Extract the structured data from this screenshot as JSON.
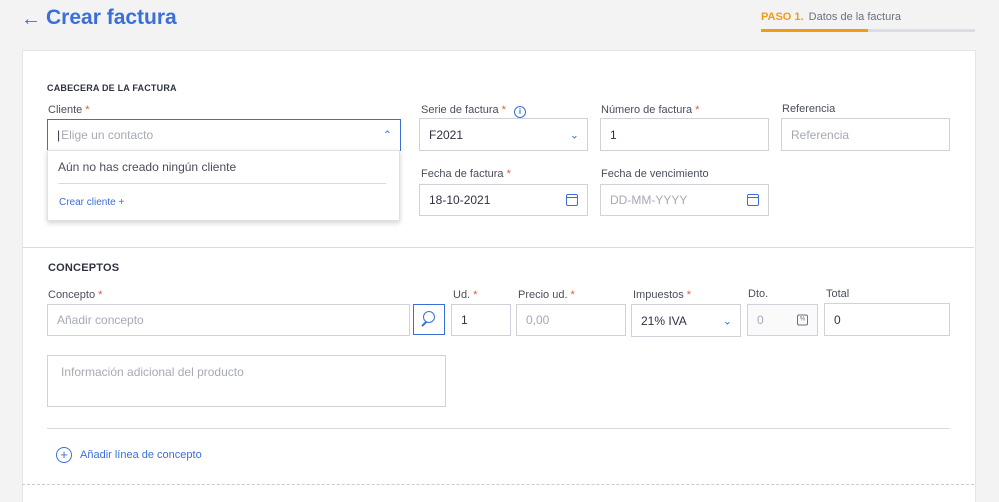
{
  "header": {
    "title": "Crear factura",
    "step_number": "PASO 1.",
    "step_label": "Datos de la factura",
    "step_progress": 0.5
  },
  "invoice_header": {
    "section_title": "CABECERA DE LA FACTURA",
    "client": {
      "label": "Cliente",
      "placeholder": "Elige un contacto"
    },
    "client_dropdown": {
      "empty_message": "Aún no has creado ningún cliente",
      "create_link": "Crear cliente +"
    },
    "series": {
      "label": "Serie de factura",
      "value": "F2021"
    },
    "number": {
      "label": "Número de factura",
      "value": "1"
    },
    "reference": {
      "label": "Referencia",
      "placeholder": "Referencia"
    },
    "invoice_date": {
      "label": "Fecha de factura",
      "value": "18-10-2021"
    },
    "due_date": {
      "label": "Fecha de vencimiento",
      "placeholder": "DD-MM-YYYY"
    }
  },
  "concepts": {
    "section_title": "CONCEPTOS",
    "concept": {
      "label": "Concepto",
      "placeholder": "Añadir concepto"
    },
    "units": {
      "label": "Ud.",
      "value": "1"
    },
    "unit_price": {
      "label": "Precio ud.",
      "placeholder": "0,00"
    },
    "taxes": {
      "label": "Impuestos",
      "value": "21% IVA"
    },
    "discount": {
      "label": "Dto.",
      "placeholder": "0"
    },
    "total": {
      "label": "Total",
      "value": "0"
    },
    "additional_info_placeholder": "Información adicional del producto",
    "add_line": "Añadir línea de concepto"
  },
  "colors": {
    "accent": "#3b6fd8",
    "step": "#f39c12",
    "required": "#e05a47"
  }
}
